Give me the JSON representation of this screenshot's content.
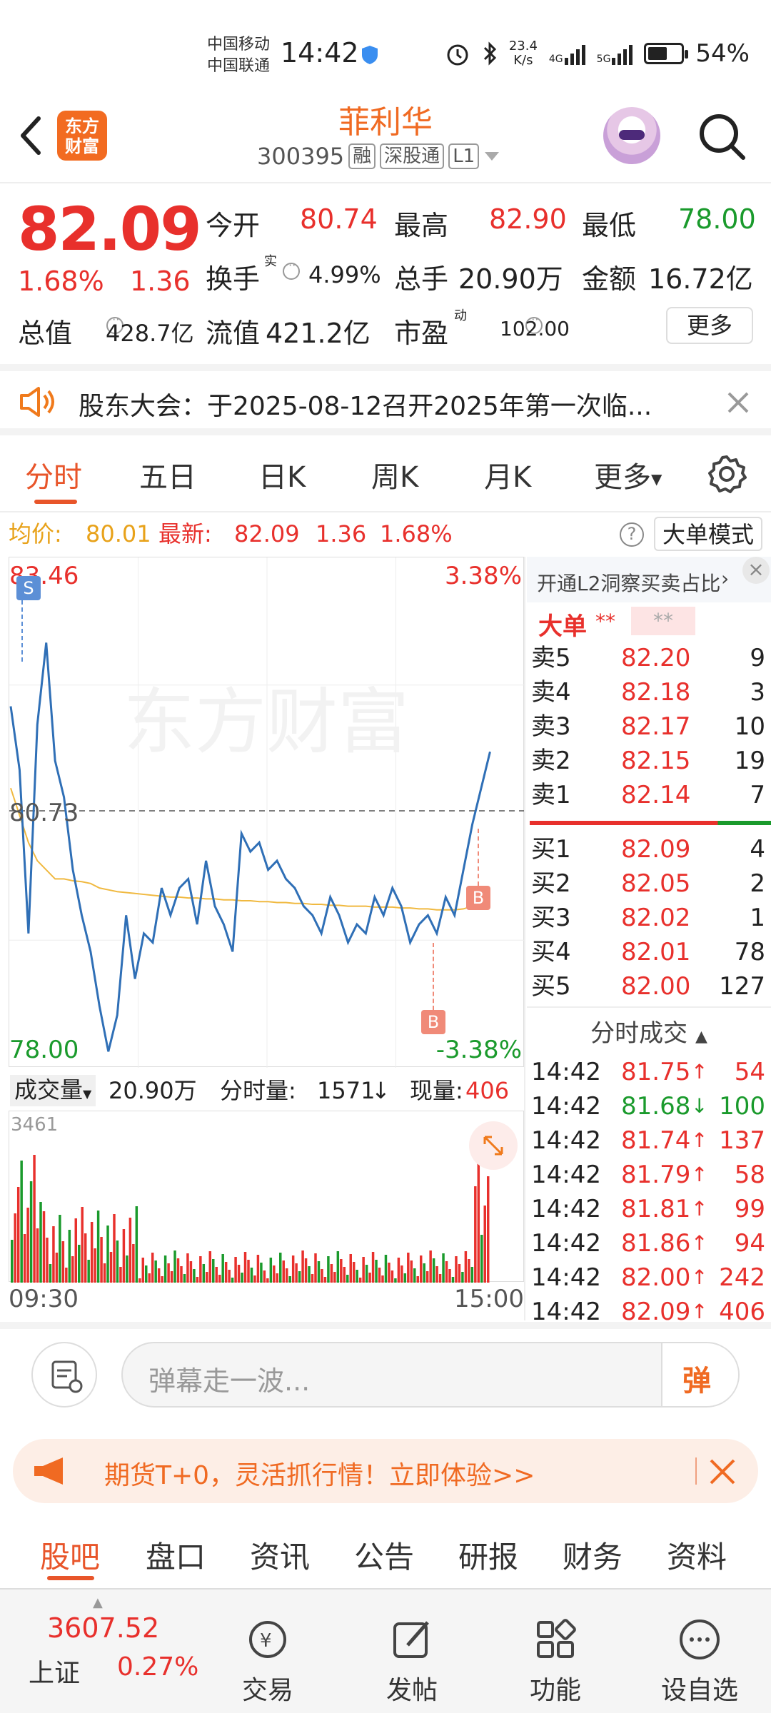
{
  "status": {
    "carrier1": "中国移动",
    "carrier2": "中国联通",
    "time": "14:42",
    "speed_top": "23.4",
    "speed_bottom": "K/s",
    "net1": "4G",
    "net2": "5G",
    "battery": "54%"
  },
  "header": {
    "logo_line1": "东方",
    "logo_line2": "财富",
    "title": "菲利华",
    "code": "300395",
    "tag_rong": "融",
    "tag_sgt": "深股通",
    "tag_l1": "L1"
  },
  "quote": {
    "price": "82.09",
    "pct": "1.68%",
    "change": "1.36",
    "open_label": "今开",
    "open": "80.74",
    "high_label": "最高",
    "high": "82.90",
    "low_label": "最低",
    "low": "78.00",
    "turnover_label": "换手",
    "turnover_sup": "实",
    "turnover": "4.99%",
    "volume_label": "总手",
    "volume": "20.90万",
    "amount_label": "金额",
    "amount": "16.72亿",
    "mktcap_label": "总值",
    "mktcap": "428.7亿",
    "float_label": "流值",
    "float": "421.2亿",
    "pe_label": "市盈",
    "pe_sup": "动",
    "pe": "102.00",
    "more": "更多"
  },
  "notice": {
    "text": "股东大会：于2025-08-12召开2025年第一次临..."
  },
  "chart_tabs": [
    "分时",
    "五日",
    "日K",
    "周K",
    "月K",
    "更多"
  ],
  "avgline": {
    "avg_label": "均价:",
    "avg": "80.01",
    "last_label": "最新:",
    "last": "82.09",
    "chg": "1.36",
    "pct": "1.68%",
    "mode": "大单模式"
  },
  "chart_data": {
    "type": "line",
    "title": "",
    "x_start": "09:30",
    "x_end": "15:00",
    "y_max": "83.46",
    "y_ref": "80.73",
    "y_min": "78.00",
    "pct_max": "3.38%",
    "pct_min": "-3.38%",
    "watermark": "东方财富",
    "price": [
      81.9,
      81.2,
      79.4,
      81.7,
      82.6,
      81.3,
      80.9,
      80.1,
      79.6,
      79.2,
      78.6,
      78.1,
      78.5,
      79.6,
      78.9,
      79.4,
      79.3,
      79.9,
      79.6,
      79.9,
      80.0,
      79.5,
      80.2,
      79.7,
      79.5,
      79.2,
      80.5,
      80.3,
      80.4,
      80.1,
      80.2,
      80.0,
      79.9,
      79.7,
      79.6,
      79.4,
      79.8,
      79.6,
      79.3,
      79.5,
      79.4,
      79.8,
      79.6,
      79.9,
      79.7,
      79.3,
      79.5,
      79.6,
      79.4,
      79.8,
      79.6,
      80.1,
      80.6,
      81.0,
      81.4
    ],
    "avg": [
      81.0,
      80.7,
      80.4,
      80.2,
      80.1,
      80.0,
      80.0,
      79.98,
      79.97,
      79.95,
      79.9,
      79.88,
      79.86,
      79.85,
      79.84,
      79.83,
      79.82,
      79.81,
      79.8,
      79.8,
      79.79,
      79.79,
      79.78,
      79.78,
      79.77,
      79.77,
      79.76,
      79.76,
      79.75,
      79.75,
      79.74,
      79.74,
      79.73,
      79.73,
      79.72,
      79.72,
      79.71,
      79.71,
      79.7,
      79.7,
      79.7,
      79.69,
      79.69,
      79.69,
      79.68,
      79.68,
      79.67,
      79.67,
      79.66,
      79.66,
      79.66,
      79.67,
      79.7,
      79.75,
      79.8
    ],
    "vol_label": "成交量",
    "vol_total": "20.90万",
    "tick_vol_label": "分时量:",
    "tick_vol": "1571",
    "cur_vol_label": "现量:",
    "cur_vol": "406",
    "vol_axis": "3461",
    "markers": [
      "S",
      "B",
      "B"
    ]
  },
  "orderbook": {
    "title": "开通L2洞察买卖占比",
    "big_label": "大单",
    "stars1": "**",
    "stars2": "**",
    "asks": [
      {
        "label": "卖5",
        "price": "82.20",
        "qty": "9"
      },
      {
        "label": "卖4",
        "price": "82.18",
        "qty": "3"
      },
      {
        "label": "卖3",
        "price": "82.17",
        "qty": "10"
      },
      {
        "label": "卖2",
        "price": "82.15",
        "qty": "19"
      },
      {
        "label": "卖1",
        "price": "82.14",
        "qty": "7"
      }
    ],
    "bids": [
      {
        "label": "买1",
        "price": "82.09",
        "qty": "4"
      },
      {
        "label": "买2",
        "price": "82.05",
        "qty": "2"
      },
      {
        "label": "买3",
        "price": "82.02",
        "qty": "1"
      },
      {
        "label": "买4",
        "price": "82.01",
        "qty": "78"
      },
      {
        "label": "买5",
        "price": "82.00",
        "qty": "127"
      }
    ],
    "ticks_title": "分时成交",
    "ticks": [
      {
        "t": "14:42",
        "p": "81.75",
        "d": "↑",
        "v": "54",
        "c": "red"
      },
      {
        "t": "14:42",
        "p": "81.68",
        "d": "↓",
        "v": "100",
        "c": "green"
      },
      {
        "t": "14:42",
        "p": "81.74",
        "d": "↑",
        "v": "137",
        "c": "red"
      },
      {
        "t": "14:42",
        "p": "81.79",
        "d": "↑",
        "v": "58",
        "c": "red"
      },
      {
        "t": "14:42",
        "p": "81.81",
        "d": "↑",
        "v": "99",
        "c": "red"
      },
      {
        "t": "14:42",
        "p": "81.86",
        "d": "↑",
        "v": "94",
        "c": "red"
      },
      {
        "t": "14:42",
        "p": "82.00",
        "d": "↑",
        "v": "242",
        "c": "red"
      },
      {
        "t": "14:42",
        "p": "82.09",
        "d": "↑",
        "v": "406",
        "c": "red"
      }
    ]
  },
  "danmu": {
    "placeholder": "弹幕走一波...",
    "btn": "弹"
  },
  "banner": {
    "text": "期货T+0，灵活抓行情！立即体验>>"
  },
  "bottom_tabs": [
    "股吧",
    "盘口",
    "资讯",
    "公告",
    "研报",
    "财务",
    "资料"
  ],
  "nav": {
    "index_value": "3607.52",
    "index_name": "上证",
    "index_pct": "0.27%",
    "items": [
      "交易",
      "发帖",
      "功能",
      "设自选"
    ]
  }
}
